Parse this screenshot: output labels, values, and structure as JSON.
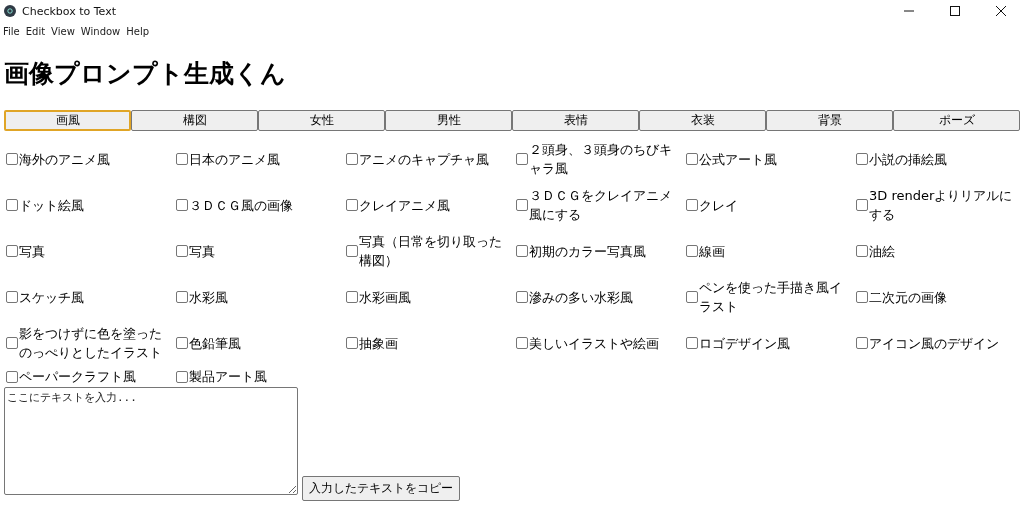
{
  "window": {
    "title": "Checkbox to Text"
  },
  "menu": [
    "File",
    "Edit",
    "View",
    "Window",
    "Help"
  ],
  "heading": "画像プロンプト生成くん",
  "tabs": [
    {
      "label": "画風",
      "selected": true
    },
    {
      "label": "構図",
      "selected": false
    },
    {
      "label": "女性",
      "selected": false
    },
    {
      "label": "男性",
      "selected": false
    },
    {
      "label": "表情",
      "selected": false
    },
    {
      "label": "衣装",
      "selected": false
    },
    {
      "label": "背景",
      "selected": false
    },
    {
      "label": "ポーズ",
      "selected": false
    }
  ],
  "options": [
    {
      "label": "海外のアニメ風",
      "checked": false
    },
    {
      "label": "日本のアニメ風",
      "checked": false
    },
    {
      "label": "アニメのキャプチャ風",
      "checked": false
    },
    {
      "label": "２頭身、３頭身のちびキャラ風",
      "checked": false
    },
    {
      "label": "公式アート風",
      "checked": false
    },
    {
      "label": "小説の挿絵風",
      "checked": false
    },
    {
      "label": "ドット絵風",
      "checked": false
    },
    {
      "label": "３ＤＣＧ風の画像",
      "checked": false
    },
    {
      "label": "クレイアニメ風",
      "checked": false
    },
    {
      "label": "３ＤＣＧをクレイアニメ風にする",
      "checked": false
    },
    {
      "label": "クレイ",
      "checked": false
    },
    {
      "label": "3D renderよりリアルにする",
      "checked": false
    },
    {
      "label": "写真",
      "checked": false
    },
    {
      "label": "写真",
      "checked": false
    },
    {
      "label": "写真（日常を切り取った構図）",
      "checked": false
    },
    {
      "label": "初期のカラー写真風",
      "checked": false
    },
    {
      "label": "線画",
      "checked": false
    },
    {
      "label": "油絵",
      "checked": false
    },
    {
      "label": "スケッチ風",
      "checked": false
    },
    {
      "label": "水彩風",
      "checked": false
    },
    {
      "label": "水彩画風",
      "checked": false
    },
    {
      "label": "滲みの多い水彩風",
      "checked": false
    },
    {
      "label": "ペンを使った手描き風イラスト",
      "checked": false
    },
    {
      "label": "二次元の画像",
      "checked": false
    },
    {
      "label": "影をつけずに色を塗ったのっぺりとしたイラスト",
      "checked": false
    },
    {
      "label": "色鉛筆風",
      "checked": false
    },
    {
      "label": "抽象画",
      "checked": false
    },
    {
      "label": "美しいイラストや絵画",
      "checked": false
    },
    {
      "label": "ロゴデザイン風",
      "checked": false
    },
    {
      "label": "アイコン風のデザイン",
      "checked": false
    },
    {
      "label": "ペーパークラフト風",
      "checked": false
    },
    {
      "label": "製品アート風",
      "checked": false
    }
  ],
  "text_area": {
    "placeholder": "ここにテキストを入力..."
  },
  "copy_button": "入力したテキストをコピー"
}
